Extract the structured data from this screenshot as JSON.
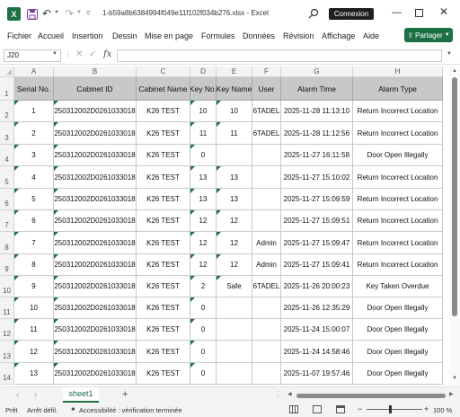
{
  "titlebar": {
    "logo": "X",
    "title": "1-b59a8b6384994f049e11f102f034b276.xlsx  -  Excel",
    "login_label": "Connexion"
  },
  "menu": [
    "Fichier",
    "Accueil",
    "Insertion",
    "Dessin",
    "Mise en page",
    "Formules",
    "Données",
    "Révision",
    "Affichage",
    "Aide"
  ],
  "share_label": "Partager",
  "formula_bar": {
    "name_box": "J20",
    "fx": "fx",
    "content": ""
  },
  "grid": {
    "columns": [
      "A",
      "B",
      "C",
      "D",
      "E",
      "F",
      "G",
      "H"
    ],
    "row_numbers": [
      "1",
      "2",
      "3",
      "4",
      "5",
      "6",
      "7",
      "8",
      "9",
      "10",
      "11",
      "12",
      "13",
      "14"
    ],
    "headers": [
      "Serial No.",
      "Cabinet ID",
      "Cabinet Name",
      "Key No.",
      "Key Name",
      "User",
      "Alarm Time",
      "Alarm Type"
    ],
    "rows": [
      [
        "1",
        "250312002D0261033018",
        "K26 TEST",
        "10",
        "10",
        "6TADEL",
        "2025-11-28 11:13:10",
        "Return Incorrect Location"
      ],
      [
        "2",
        "250312002D0261033018",
        "K26 TEST",
        "11",
        "11",
        "6TADEL",
        "2025-11-28 11:12:56",
        "Return Incorrect Location"
      ],
      [
        "3",
        "250312002D0261033018",
        "K26 TEST",
        "0",
        "",
        "",
        "2025-11-27 16:11:58",
        "Door Open Illegally"
      ],
      [
        "4",
        "250312002D0261033018",
        "K26 TEST",
        "13",
        "13",
        "",
        "2025-11-27 15:10:02",
        "Return Incorrect Location"
      ],
      [
        "5",
        "250312002D0261033018",
        "K26 TEST",
        "13",
        "13",
        "",
        "2025-11-27 15:09:59",
        "Return Incorrect Location"
      ],
      [
        "6",
        "250312002D0261033018",
        "K26 TEST",
        "12",
        "12",
        "",
        "2025-11-27 15:09:51",
        "Return Incorrect Location"
      ],
      [
        "7",
        "250312002D0261033018",
        "K26 TEST",
        "12",
        "12",
        "Admin",
        "2025-11-27 15:09:47",
        "Return Incorrect Location"
      ],
      [
        "8",
        "250312002D0261033018",
        "K26 TEST",
        "12",
        "12",
        "Admin",
        "2025-11-27 15:09:41",
        "Return Incorrect Location"
      ],
      [
        "9",
        "250312002D0261033018",
        "K26 TEST",
        "2",
        "Safe",
        "6TADEL",
        "2025-11-26 20:00:23",
        "Key Taken Overdue"
      ],
      [
        "10",
        "250312002D0261033018",
        "K26 TEST",
        "0",
        "",
        "",
        "2025-11-26 12:35:29",
        "Door Open Illegally"
      ],
      [
        "11",
        "250312002D0261033018",
        "K26 TEST",
        "0",
        "",
        "",
        "2025-11-24 15:00:07",
        "Door Open Illegally"
      ],
      [
        "12",
        "250312002D0261033018",
        "K26 TEST",
        "0",
        "",
        "",
        "2025-11-24 14:58:46",
        "Door Open Illegally"
      ],
      [
        "13",
        "250312002D0261033018",
        "K26 TEST",
        "0",
        "",
        "",
        "2025-11-07 19:57:46",
        "Door Open Illegally"
      ]
    ]
  },
  "sheet_tab": "sheet1",
  "status": {
    "ready": "Prêt",
    "scroll": "Arrêt défil.",
    "accessibility": "Accessibilité : vérification terminée",
    "zoom": "100 %"
  },
  "colors": {
    "excel_green": "#1d7044",
    "header_fill": "#c8c8c8"
  }
}
